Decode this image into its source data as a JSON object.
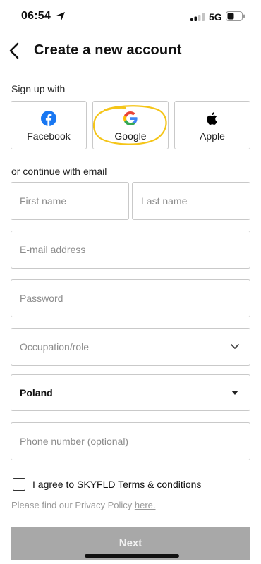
{
  "status": {
    "time": "06:54",
    "network": "5G"
  },
  "header": {
    "title": "Create a new account"
  },
  "signup": {
    "label": "Sign up with",
    "providers": [
      {
        "label": "Facebook",
        "icon": "facebook-icon",
        "color": "#1877F2"
      },
      {
        "label": "Google",
        "icon": "google-icon"
      },
      {
        "label": "Apple",
        "icon": "apple-icon",
        "color": "#000000"
      }
    ]
  },
  "email_section": {
    "label": "or continue with email"
  },
  "form": {
    "first_name_placeholder": "First name",
    "last_name_placeholder": "Last name",
    "email_placeholder": "E-mail address",
    "password_placeholder": "Password",
    "occupation_placeholder": "Occupation/role",
    "country_value": "Poland",
    "phone_placeholder": "Phone number (optional)"
  },
  "terms": {
    "agree_prefix": "I agree to SKYFLD ",
    "terms_link": "Terms & conditions",
    "privacy_prefix": "Please find our Privacy Policy ",
    "privacy_link": "here."
  },
  "footer": {
    "next_label": "Next"
  },
  "colors": {
    "highlight_ring": "#F5C518",
    "disabled_button": "#A8A8A8"
  }
}
